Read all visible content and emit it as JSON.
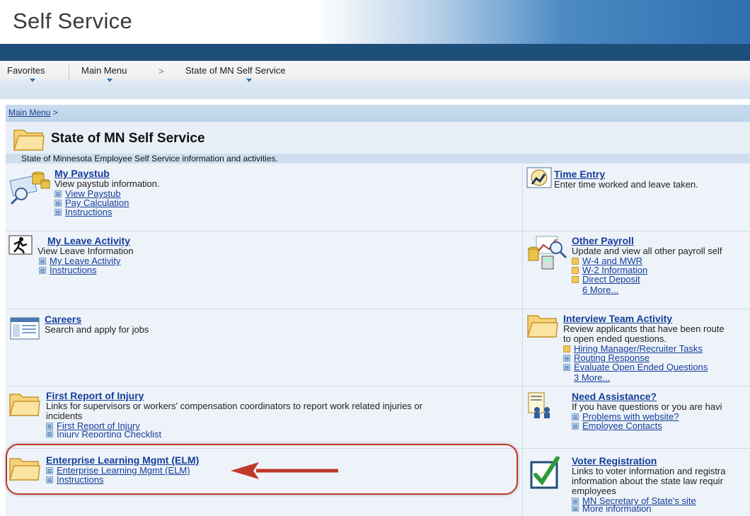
{
  "app": {
    "title": "Self Service"
  },
  "nav": {
    "favorites": "Favorites",
    "main_menu": "Main Menu",
    "chevron": ">",
    "current": "State of MN Self Service"
  },
  "breadcrumb": {
    "main_menu": "Main Menu",
    "sep": " >"
  },
  "page": {
    "title": "State of MN Self Service",
    "description": "State of Minnesota Employee Self Service information and activities."
  },
  "tiles": {
    "paystub": {
      "title": "My Paystub",
      "description": "View paystub information.",
      "links": [
        "View Paystub",
        "Pay Calculation",
        "Instructions"
      ]
    },
    "time_entry": {
      "title": "Time Entry",
      "description": "Enter time worked and leave taken."
    },
    "leave": {
      "title": "My Leave Activity",
      "description": "View Leave Information",
      "links": [
        "My Leave Activity",
        "Instructions"
      ]
    },
    "other_payroll": {
      "title": "Other Payroll",
      "description": "Update and view all other payroll self",
      "links": [
        "W-4 and MWR",
        "W-2 Information",
        "Direct Deposit"
      ],
      "more": "6 More..."
    },
    "careers": {
      "title": "Careers",
      "description": "Search and apply for jobs"
    },
    "interview": {
      "title": "Interview Team Activity",
      "description_1": "Review applicants that have been route",
      "description_2": "to open ended questions.",
      "links": [
        "Hiring Manager/Recruiter Tasks",
        "Routing Response",
        "Evaluate Open Ended Questions"
      ],
      "more": "3 More..."
    },
    "injury": {
      "title": "First Report of Injury",
      "description_1": "Links for supervisors or workers' compensation coordinators to report work related injuries or",
      "description_2": "incidents",
      "links": [
        "First Report of Injury",
        "Injury Reporting Checklist"
      ]
    },
    "assistance": {
      "title": "Need Assistance?",
      "description": "If you have questions or you are havi",
      "links": [
        "Problems with website?",
        "Employee Contacts"
      ]
    },
    "elm": {
      "title": "Enterprise Learning Mgmt (ELM)",
      "links": [
        "Enterprise Learning Mgmt (ELM)",
        "Instructions"
      ]
    },
    "voter": {
      "title": "Voter Registration",
      "description_1": "Links to voter information and registra",
      "description_2": "information about the state law requir",
      "description_3": "employees",
      "links": [
        "MN Secretary of State's site",
        "More information"
      ]
    }
  },
  "colors": {
    "link": "#143e9a",
    "annotation": "#c0392b",
    "header_dark": "#1e4e7a"
  }
}
